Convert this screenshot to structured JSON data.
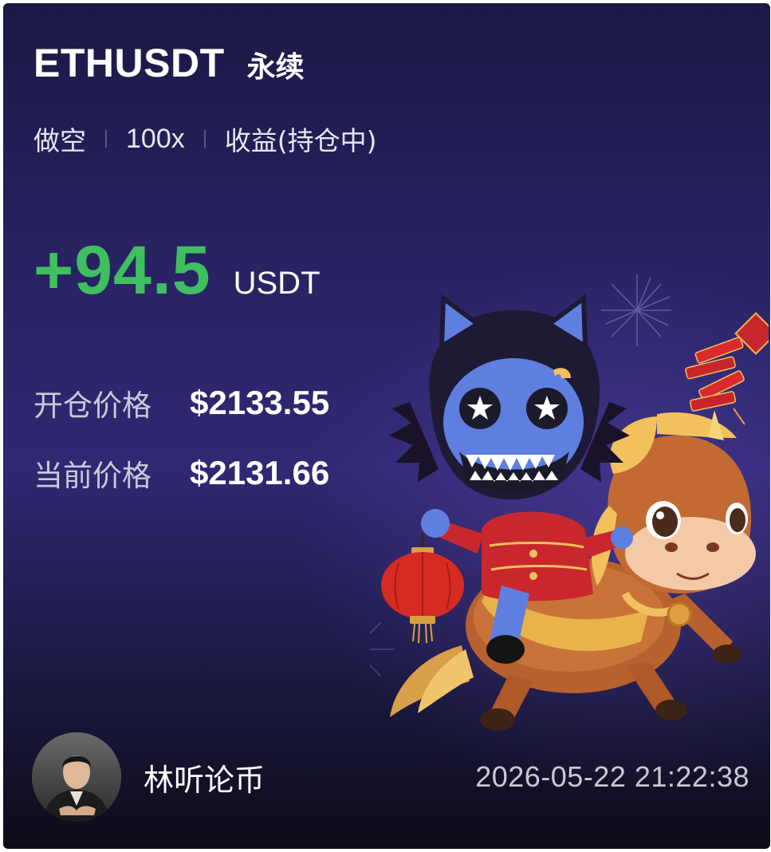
{
  "header": {
    "symbol": "ETHUSDT",
    "contract_type": "永续"
  },
  "tags": {
    "direction": "做空",
    "leverage": "100x",
    "status": "收益(持仓中)"
  },
  "pnl": {
    "value": "+94.5",
    "unit": "USDT",
    "color": "#3fbf5f"
  },
  "prices": {
    "open_label": "开仓价格",
    "open_value": "$2133.55",
    "current_label": "当前价格",
    "current_value": "$2131.66"
  },
  "footer": {
    "author": "林听论币",
    "timestamp": "2026-05-22 21:22:38"
  },
  "icons": {
    "avatar": "user-avatar-photo",
    "mascot": "blue-cat-mascot-riding-horse",
    "lantern": "red-lantern-icon",
    "firecrackers": "firecrackers-icon",
    "fireworks": "fireworks-icon"
  },
  "theme": {
    "background_top": "#1b1945",
    "background_mid": "#302873",
    "background_bottom": "#0c0c18",
    "text_primary": "#ffffff",
    "text_secondary": "#c9c9d8"
  }
}
